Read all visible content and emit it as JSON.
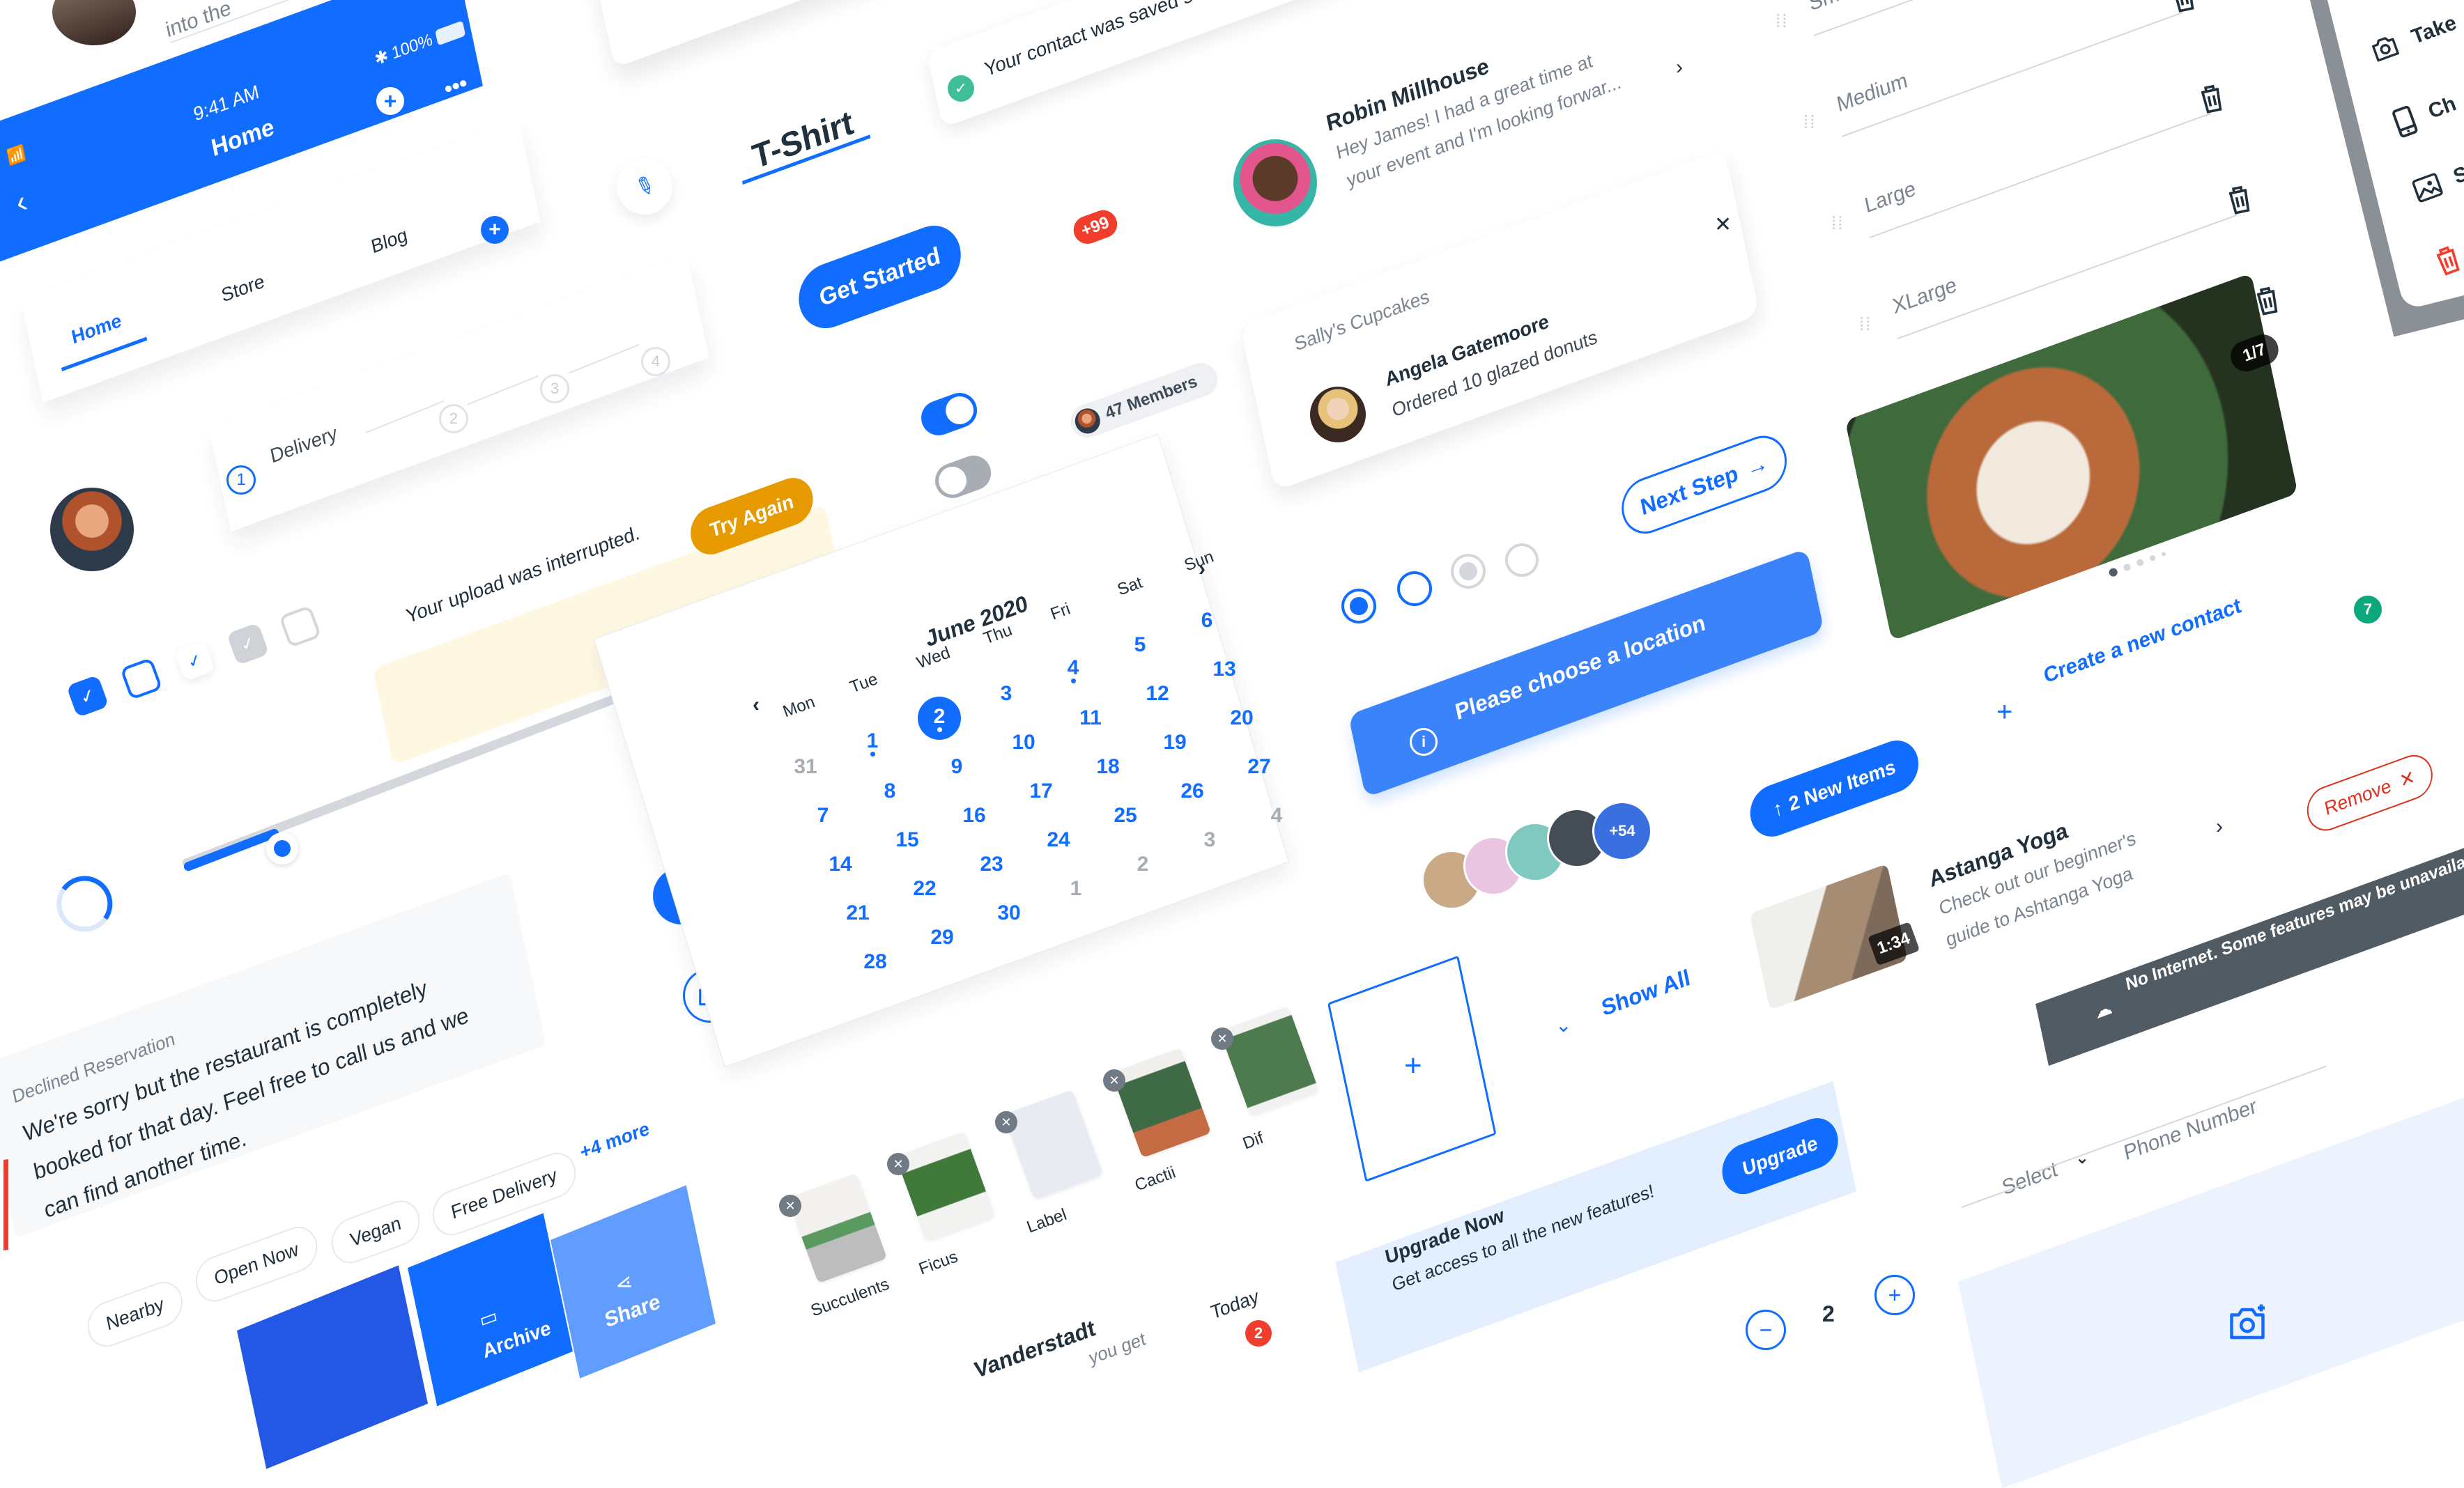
{
  "top_fragment": {
    "text": "into the"
  },
  "phone_header": {
    "time": "9:41 AM",
    "battery": "100%",
    "title": "Home",
    "icons": [
      "signal-icon",
      "wifi-icon",
      "bluetooth-icon",
      "battery-icon",
      "back-icon",
      "add-icon",
      "more-icon"
    ]
  },
  "tabs": {
    "items": [
      {
        "label": "Home",
        "active": true
      },
      {
        "label": "Store",
        "active": false
      },
      {
        "label": "Blog",
        "active": false
      }
    ]
  },
  "stepper": {
    "steps": [
      {
        "num": "1",
        "label": "Delivery",
        "active": true
      },
      {
        "num": "2"
      },
      {
        "num": "3"
      },
      {
        "num": "4"
      }
    ]
  },
  "title_tab": {
    "label": "T-Shirt"
  },
  "toast_success": {
    "text": "Your contact was saved successfully"
  },
  "get_started": {
    "label": "Get Started"
  },
  "badge_count": {
    "text": "+99"
  },
  "toggles": [
    {
      "state": "on"
    },
    {
      "state": "off"
    }
  ],
  "members_chip": {
    "text": "47 Members"
  },
  "message_preview": {
    "name": "Robin Millhouse",
    "text_line1": "Hey James! I had a great time at",
    "text_line2": "your event and I'm looking forwar..."
  },
  "notification_card": {
    "store": "Sally's Cupcakes",
    "name": "Angela Gatemoore",
    "text": "Ordered 10 glazed donuts"
  },
  "upload_warning": {
    "text": "Your upload was interrupted.",
    "action": "Try Again"
  },
  "checkboxes": [
    {
      "state": "checked"
    },
    {
      "state": "unchecked-focus"
    },
    {
      "state": "checked-light"
    },
    {
      "state": "checked-disabled"
    },
    {
      "state": "unchecked-disabled"
    }
  ],
  "slider": {
    "value": 0.2
  },
  "spinner": {
    "progress": 0.3
  },
  "calendar": {
    "title": "June 2020",
    "weekdays": [
      "Mon",
      "Tue",
      "Wed",
      "Thu",
      "Fri",
      "Sat",
      "Sun"
    ],
    "weeks": [
      [
        {
          "d": "31",
          "muted": true
        },
        {
          "d": "1",
          "dot": true
        },
        {
          "d": "2",
          "selected": true,
          "dot": true
        },
        {
          "d": "3"
        },
        {
          "d": "4",
          "dot": true
        },
        {
          "d": "5"
        },
        {
          "d": "6"
        }
      ],
      [
        {
          "d": "7"
        },
        {
          "d": "8"
        },
        {
          "d": "9"
        },
        {
          "d": "10"
        },
        {
          "d": "11"
        },
        {
          "d": "12"
        },
        {
          "d": "13"
        }
      ],
      [
        {
          "d": "14"
        },
        {
          "d": "15"
        },
        {
          "d": "16"
        },
        {
          "d": "17"
        },
        {
          "d": "18"
        },
        {
          "d": "19"
        },
        {
          "d": "20"
        }
      ],
      [
        {
          "d": "21"
        },
        {
          "d": "22"
        },
        {
          "d": "23"
        },
        {
          "d": "24"
        },
        {
          "d": "25"
        },
        {
          "d": "26"
        },
        {
          "d": "27"
        }
      ],
      [
        {
          "d": "28"
        },
        {
          "d": "29"
        },
        {
          "d": "30"
        },
        {
          "d": "1",
          "muted": true
        },
        {
          "d": "2",
          "muted": true
        },
        {
          "d": "3",
          "muted": true
        },
        {
          "d": "4",
          "muted": true
        }
      ]
    ]
  },
  "radios": [
    {
      "state": "selected"
    },
    {
      "state": "unselected"
    },
    {
      "state": "disabled-selected"
    },
    {
      "state": "disabled"
    }
  ],
  "next_step": {
    "label": "Next Step"
  },
  "tooltip": {
    "text": "Please choose a location"
  },
  "new_items": {
    "label": "2 New Items"
  },
  "avatar_stack": {
    "overflow": "+54"
  },
  "size_list": {
    "items": [
      "Small",
      "Medium",
      "Large",
      "XLarge"
    ]
  },
  "action_sheet": {
    "items": [
      {
        "label": "Take",
        "icon": "camera-icon"
      },
      {
        "label": "Ch",
        "icon": "phone-icon"
      },
      {
        "label": "S",
        "icon": "image-icon"
      },
      {
        "label": "",
        "icon": "trash-icon"
      }
    ]
  },
  "gallery": {
    "counter": "1/7",
    "dots": 5,
    "active_dot": 0
  },
  "green_badge": {
    "text": "7"
  },
  "create_contact": {
    "label": "Create a new contact"
  },
  "remove_chip": {
    "label": "Remove"
  },
  "video_item": {
    "title": "Astanga Yoga",
    "line1": "Check out our beginner's",
    "line2": "guide to Ashtanga Yoga",
    "duration": "1:34"
  },
  "offline_banner": {
    "text": "No Internet. Some features may be unavailable"
  },
  "phone_field": {
    "select": "Select",
    "placeholder": "Phone Number"
  },
  "fab": {
    "icon": "add-icon"
  },
  "camera_button": {
    "icon": "camera-icon"
  },
  "declined": {
    "title": "Declined Reservation",
    "body_line1": "We're sorry but the restaurant is completely",
    "body_line2": "booked for that day. Feel free to call us and we",
    "body_line3": "can find another time."
  },
  "chips": {
    "items": [
      "Nearby",
      "Open Now",
      "Vegan",
      "Free Delivery"
    ],
    "more": "+4 more"
  },
  "swipe_actions": {
    "items": [
      {
        "label": "",
        "icon": ""
      },
      {
        "label": "Archive",
        "icon": "archive-icon"
      },
      {
        "label": "Share",
        "icon": "share-icon"
      }
    ]
  },
  "show_all": {
    "label": "Show All"
  },
  "add_tile": {
    "icon": "add-icon"
  },
  "upgrade_banner": {
    "title": "Upgrade Now",
    "text": "Get access to all the new features!",
    "action": "Upgrade"
  },
  "quantity": {
    "value": "2"
  },
  "thumbnails": {
    "items": [
      {
        "label": "Succulents"
      },
      {
        "label": "Ficus"
      },
      {
        "label": "Label",
        "placeholder": true
      },
      {
        "label": "Cactii"
      },
      {
        "label": "Dif"
      }
    ]
  },
  "inbox_item": {
    "name": "Vanderstadt",
    "preview": "you get",
    "time": "Today",
    "unread": "2"
  },
  "colors": {
    "primary": "#116dff",
    "danger": "#f23d2c",
    "warning": "#e79a00",
    "success": "#3fbf99",
    "green_badge": "#0aa87a",
    "dark": "#20303c",
    "offline": "#505b64"
  }
}
